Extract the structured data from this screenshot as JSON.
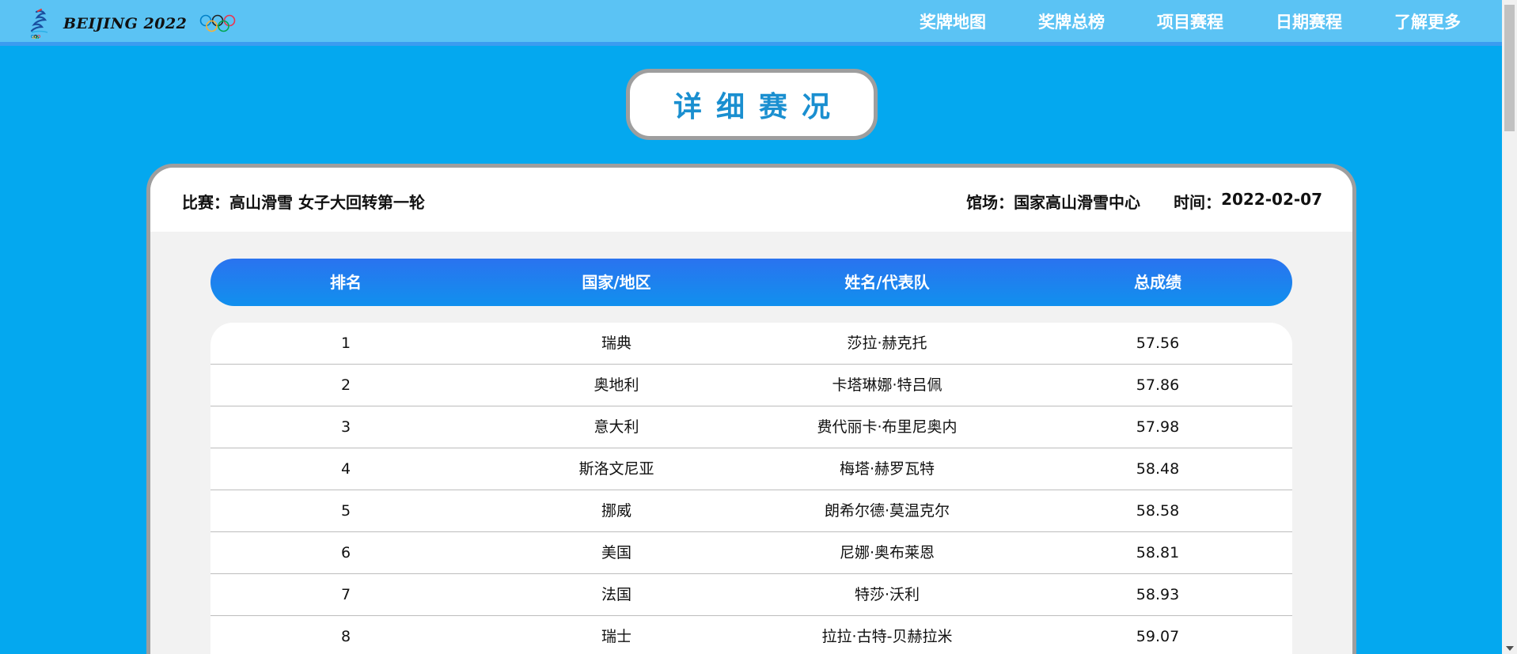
{
  "header": {
    "logo_text": "BEIJING 2022",
    "nav": [
      "奖牌地图",
      "奖牌总榜",
      "项目赛程",
      "日期赛程",
      "了解更多"
    ]
  },
  "title": "详细赛况",
  "info": {
    "match_label": "比赛：",
    "match_value": "高山滑雪 女子大回转第一轮",
    "venue_label": "馆场：",
    "venue_value": "国家高山滑雪中心",
    "time_label": "时间：",
    "time_value": "2022-02-07"
  },
  "table": {
    "columns": [
      "排名",
      "国家/地区",
      "姓名/代表队",
      "总成绩"
    ],
    "rows": [
      [
        "1",
        "瑞典",
        "莎拉·赫克托",
        "57.56"
      ],
      [
        "2",
        "奥地利",
        "卡塔琳娜·特吕佩",
        "57.86"
      ],
      [
        "3",
        "意大利",
        "费代丽卡·布里尼奥内",
        "57.98"
      ],
      [
        "4",
        "斯洛文尼亚",
        "梅塔·赫罗瓦特",
        "58.48"
      ],
      [
        "5",
        "挪威",
        "朗希尔德·莫温克尔",
        "58.58"
      ],
      [
        "6",
        "美国",
        "尼娜·奥布莱恩",
        "58.81"
      ],
      [
        "7",
        "法国",
        "特莎·沃利",
        "58.93"
      ],
      [
        "8",
        "瑞士",
        "拉拉·古特-贝赫拉米",
        "59.07"
      ]
    ]
  },
  "colors": {
    "page_bg": "#04a8ef",
    "topbar_bg": "#5bc3f4",
    "title_text": "#1a8fd0",
    "table_header": "#2a73ef"
  }
}
